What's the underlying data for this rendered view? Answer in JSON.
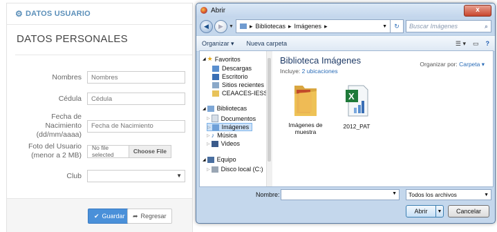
{
  "form": {
    "header": "DATOS USUARIO",
    "section_title": "DATOS PERSONALES",
    "fields": [
      {
        "label": "Nombres",
        "placeholder": "Nombres"
      },
      {
        "label": "Cédula",
        "placeholder": "Cédula"
      },
      {
        "label": "Fecha de Nacimiento (dd/mm/aaaa)",
        "placeholder": "Fecha de Nacimiento"
      },
      {
        "label": "Foto del Usuario (menor a 2 MB)"
      },
      {
        "label": "Club"
      }
    ],
    "file_status": "No file selected",
    "choose_file": "Choose File",
    "save_label": "Guardar",
    "back_label": "Regresar",
    "accent_color": "#4a90d9"
  },
  "dialog": {
    "title": "Abrir",
    "close": "x",
    "breadcrumb": [
      "Bibliotecas",
      "Imágenes"
    ],
    "search_placeholder": "Buscar Imágenes",
    "toolbar": {
      "organize": "Organizar ▾",
      "new_folder": "Nueva carpeta"
    },
    "nav": {
      "favorites": "Favoritos",
      "fav_items": [
        "Descargas",
        "Escritorio",
        "Sitios recientes",
        "CEAACES-IESS"
      ],
      "libraries": "Bibliotecas",
      "lib_items": [
        "Documentos",
        "Imágenes",
        "Música",
        "Videos"
      ],
      "computer": "Equipo",
      "computer_items": [
        "Disco local (C:)"
      ]
    },
    "library_title": "Biblioteca Imágenes",
    "library_sub_prefix": "Incluye:",
    "library_sub_link": "2 ubicaciones",
    "arrange_label": "Organizar por:",
    "arrange_value": "Carpeta ▾",
    "files": [
      {
        "name": "Imágenes de muestra",
        "icon": "folder-icon"
      },
      {
        "name": "2012_PAT",
        "icon": "excel-file-icon"
      }
    ],
    "filename_label": "Nombre:",
    "filetype": "Todos los archivos",
    "open_label": "Abrir",
    "cancel_label": "Cancelar"
  }
}
